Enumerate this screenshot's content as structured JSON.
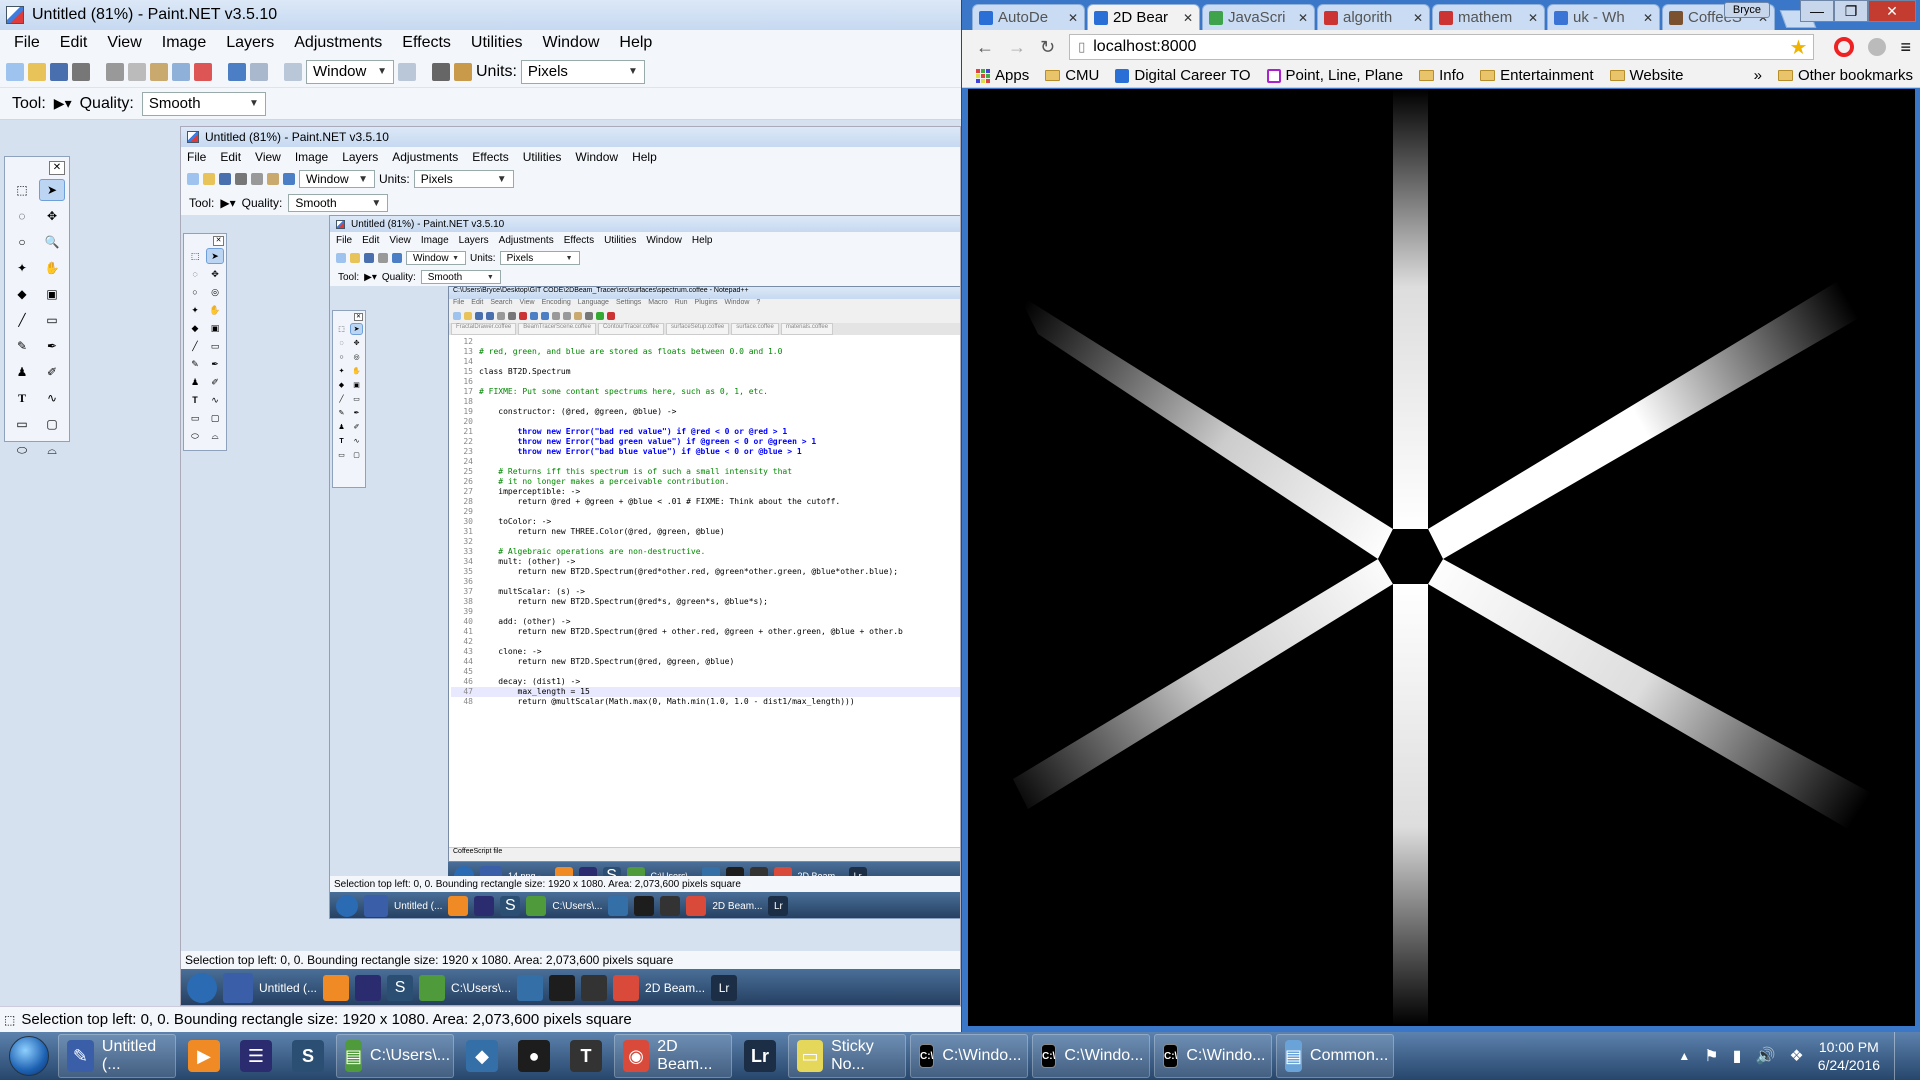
{
  "paint": {
    "title": "Untitled (81%) - Paint.NET v3.5.10",
    "menu": [
      "File",
      "Edit",
      "View",
      "Image",
      "Layers",
      "Adjustments",
      "Effects",
      "Utilities",
      "Window",
      "Help"
    ],
    "zoom_mode": "Window",
    "units_label": "Units:",
    "units_value": "Pixels",
    "tool_label": "Tool:",
    "quality_label": "Quality:",
    "quality_value": "Smooth",
    "status": "Selection top left: 0, 0. Bounding rectangle size: 1920 x 1080. Area: 2,073,600 pixels square"
  },
  "notepad": {
    "title": "C:\\Users\\Bryce\\Desktop\\GIT CODE\\2DBeam_Tracer\\src\\surfaces\\spectrum.coffee - Notepad++",
    "menu": [
      "File",
      "Edit",
      "Search",
      "View",
      "Encoding",
      "Language",
      "Settings",
      "Macro",
      "Run",
      "Plugins",
      "Window",
      "?"
    ],
    "file_tabs": [
      "FractalDrawer.coffee",
      "BeamTracerScene.coffee",
      "ContourTracer.coffee",
      "surfaceSetup.coffee",
      "surface.coffee",
      "materials.coffee"
    ],
    "lines": [
      {
        "n": "12",
        "t": ""
      },
      {
        "n": "13",
        "t": "# red, green, and blue are stored as floats between 0.0 and 1.0",
        "c": "cm"
      },
      {
        "n": "14",
        "t": ""
      },
      {
        "n": "15",
        "t": "class BT2D.Spectrum"
      },
      {
        "n": "16",
        "t": ""
      },
      {
        "n": "17",
        "t": "# FIXME: Put some contant spectrums here, such as 0, 1, etc.",
        "c": "cm"
      },
      {
        "n": "18",
        "t": ""
      },
      {
        "n": "19",
        "t": "    constructor: (@red, @green, @blue) ->"
      },
      {
        "n": "20",
        "t": ""
      },
      {
        "n": "21",
        "t": "        throw new Error(\"bad red value\") if @red < 0 or @red > 1",
        "c": "kw"
      },
      {
        "n": "22",
        "t": "        throw new Error(\"bad green value\") if @green < 0 or @green > 1",
        "c": "kw"
      },
      {
        "n": "23",
        "t": "        throw new Error(\"bad blue value\") if @blue < 0 or @blue > 1",
        "c": "kw"
      },
      {
        "n": "24",
        "t": ""
      },
      {
        "n": "25",
        "t": "    # Returns iff this spectrum is of such a small intensity that",
        "c": "cm"
      },
      {
        "n": "26",
        "t": "    # it no longer makes a perceivable contribution.",
        "c": "cm"
      },
      {
        "n": "27",
        "t": "    imperceptible: ->"
      },
      {
        "n": "28",
        "t": "        return @red + @green + @blue < .01 # FIXME: Think about the cutoff."
      },
      {
        "n": "29",
        "t": ""
      },
      {
        "n": "30",
        "t": "    toColor: ->"
      },
      {
        "n": "31",
        "t": "        return new THREE.Color(@red, @green, @blue)"
      },
      {
        "n": "32",
        "t": ""
      },
      {
        "n": "33",
        "t": "    # Algebraic operations are non-destructive.",
        "c": "cm"
      },
      {
        "n": "34",
        "t": "    mult: (other) ->"
      },
      {
        "n": "35",
        "t": "        return new BT2D.Spectrum(@red*other.red, @green*other.green, @blue*other.blue);"
      },
      {
        "n": "36",
        "t": ""
      },
      {
        "n": "37",
        "t": "    multScalar: (s) ->"
      },
      {
        "n": "38",
        "t": "        return new BT2D.Spectrum(@red*s, @green*s, @blue*s);"
      },
      {
        "n": "39",
        "t": ""
      },
      {
        "n": "40",
        "t": "    add: (other) ->"
      },
      {
        "n": "41",
        "t": "        return new BT2D.Spectrum(@red + other.red, @green + other.green, @blue + other.b"
      },
      {
        "n": "42",
        "t": ""
      },
      {
        "n": "43",
        "t": "    clone: ->"
      },
      {
        "n": "44",
        "t": "        return new BT2D.Spectrum(@red, @green, @blue)"
      },
      {
        "n": "45",
        "t": ""
      },
      {
        "n": "46",
        "t": "    decay: (dist1) ->"
      },
      {
        "n": "47",
        "t": "        max_length = 15"
      },
      {
        "n": "48",
        "t": "        return @multScalar(Math.max(0, Math.min(1.0, 1.0 - dist1/max_length)))"
      }
    ],
    "status": "CoffeeScript file"
  },
  "nested_taskbar": {
    "level2": [
      "Untitled (...",
      "C:\\Users\\...",
      "2D Beam..."
    ],
    "level3": [
      "14.png -...",
      "C:\\Users\\...",
      "2D Beam..."
    ]
  },
  "chrome": {
    "user": "Bryce",
    "tabs": [
      {
        "label": "AutoDe",
        "color": "#2a6fd6"
      },
      {
        "label": "2D Bear",
        "color": "#2a6fd6",
        "active": true
      },
      {
        "label": "JavaScri",
        "color": "#3ea34a"
      },
      {
        "label": "algorith",
        "color": "#c33"
      },
      {
        "label": "mathem",
        "color": "#c33"
      },
      {
        "label": "uk - Wh",
        "color": "#3a75d6"
      },
      {
        "label": "CoffeeS",
        "color": "#7a5230"
      }
    ],
    "url": "localhost:8000",
    "bookmarks": [
      "Apps",
      "CMU",
      "Digital Career TO",
      "Point, Line, Plane",
      "Info",
      "Entertainment",
      "Website"
    ],
    "bookmarks_more": "»",
    "other_bookmarks": "Other bookmarks"
  },
  "taskbar": {
    "items": [
      {
        "label": "Untitled (...",
        "icon": "paintnet-icon",
        "color": "#3a5fa8"
      },
      {
        "label": "",
        "icon": "media-player-icon",
        "color": "#f08a24"
      },
      {
        "label": "",
        "icon": "eclipse-icon",
        "color": "#2b2b6f"
      },
      {
        "label": "",
        "icon": "sublime-icon",
        "color": "#2a4f73"
      },
      {
        "label": "C:\\Users\\...",
        "icon": "explorer-icon",
        "color": "#4f9a3a"
      },
      {
        "label": "",
        "icon": "python-icon",
        "color": "#356fa8"
      },
      {
        "label": "",
        "icon": "github-icon",
        "color": "#1d1d1d"
      },
      {
        "label": "",
        "icon": "typora-icon",
        "color": "#333"
      },
      {
        "label": "2D Beam...",
        "icon": "chrome-icon",
        "color": "#d94a3b"
      },
      {
        "label": "",
        "icon": "lightroom-icon",
        "color": "#1b2e45"
      },
      {
        "label": "Sticky No...",
        "icon": "sticky-notes-icon",
        "color": "#e5d75a"
      },
      {
        "label": "C:\\Windo...",
        "icon": "cmd-icon",
        "color": "#000"
      },
      {
        "label": "C:\\Windo...",
        "icon": "cmd-icon",
        "color": "#000"
      },
      {
        "label": "C:\\Windo...",
        "icon": "cmd-icon",
        "color": "#000"
      },
      {
        "label": "Common...",
        "icon": "common-icon",
        "color": "#6aa3d8"
      }
    ],
    "time": "10:00 PM",
    "date": "6/24/2016"
  }
}
